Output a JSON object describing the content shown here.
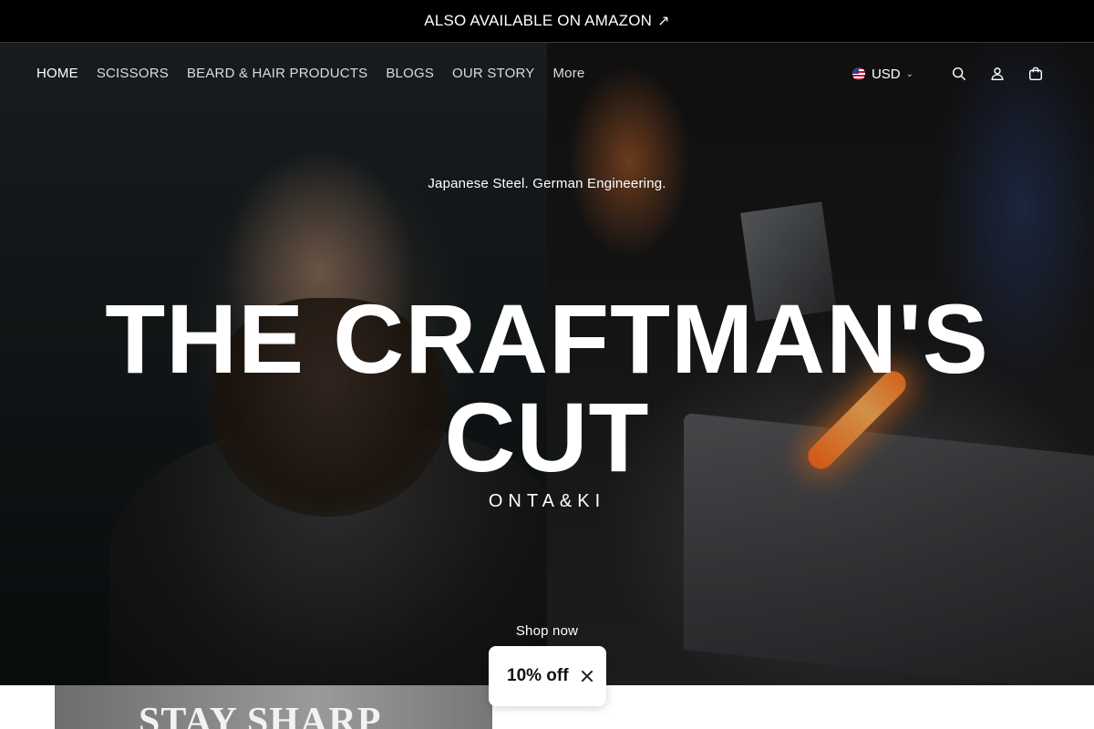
{
  "announcement": {
    "text": "ALSO AVAILABLE ON AMAZON",
    "arrow": "↗"
  },
  "nav": {
    "items": [
      {
        "label": "HOME",
        "active": true
      },
      {
        "label": "SCISSORS",
        "active": false
      },
      {
        "label": "BEARD & HAIR PRODUCTS",
        "active": false
      },
      {
        "label": "BLOGS",
        "active": false
      },
      {
        "label": "OUR STORY",
        "active": false
      },
      {
        "label": "More",
        "active": false
      }
    ]
  },
  "header_tools": {
    "currency": "USD",
    "icons": [
      "search-icon",
      "account-icon",
      "cart-icon"
    ]
  },
  "hero": {
    "subtitle": "Japanese Steel. German Engineering.",
    "title": "THE CRAFTMAN'S CUT",
    "brand": "ONTA&KI",
    "cta": "Shop now"
  },
  "promo": {
    "stay_sharp": "STAY SHARP"
  },
  "discount_popup": {
    "label": "10% off"
  },
  "colors": {
    "announcement_bg": "#000000",
    "text_on_dark": "#ffffff",
    "popup_bg": "#ffffff"
  }
}
